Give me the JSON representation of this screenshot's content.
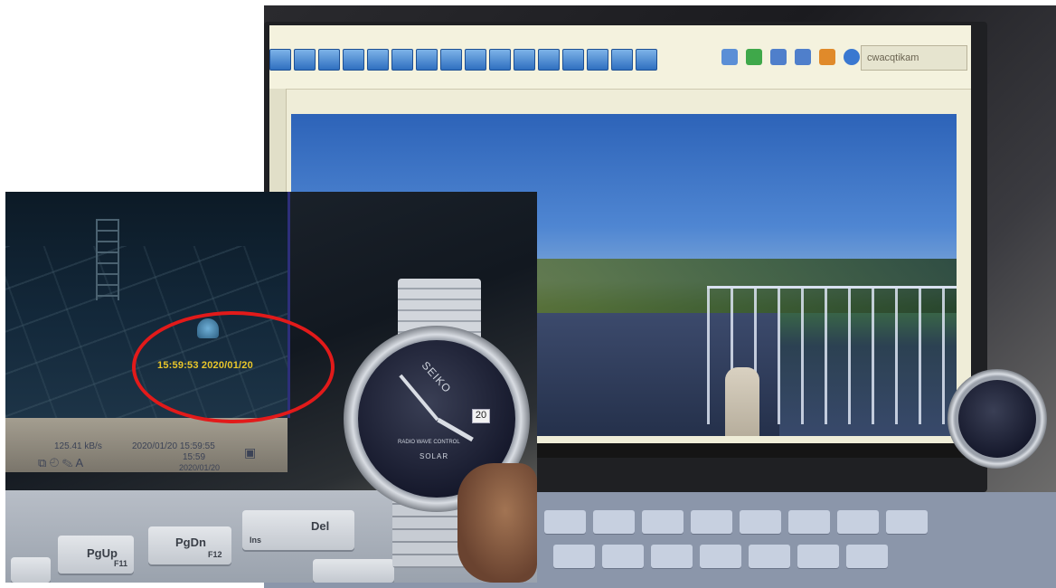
{
  "background_photo": {
    "camera_app": {
      "menu_label": "cwacqtikam"
    }
  },
  "inset_photo": {
    "screen_timestamp": "15:59:53 2020/01/20",
    "taskbar": {
      "speed": "125.41 kB/s",
      "date_time": "2020/01/20 15:59:55",
      "tray_time": "15:59",
      "tray_date": "2020/01/20"
    },
    "keys": {
      "pgup": "PgUp",
      "pgup_sub": "F11",
      "pgdn": "PgDn",
      "pgdn_sub": "F12",
      "del": "Del",
      "ins": "Ins"
    },
    "watch": {
      "brand": "SEIKO",
      "date": "20",
      "dial_text_1": "RADIO WAVE CONTROL",
      "dial_text_2": "SOLAR"
    },
    "highlight_color": "#e21a1a"
  }
}
